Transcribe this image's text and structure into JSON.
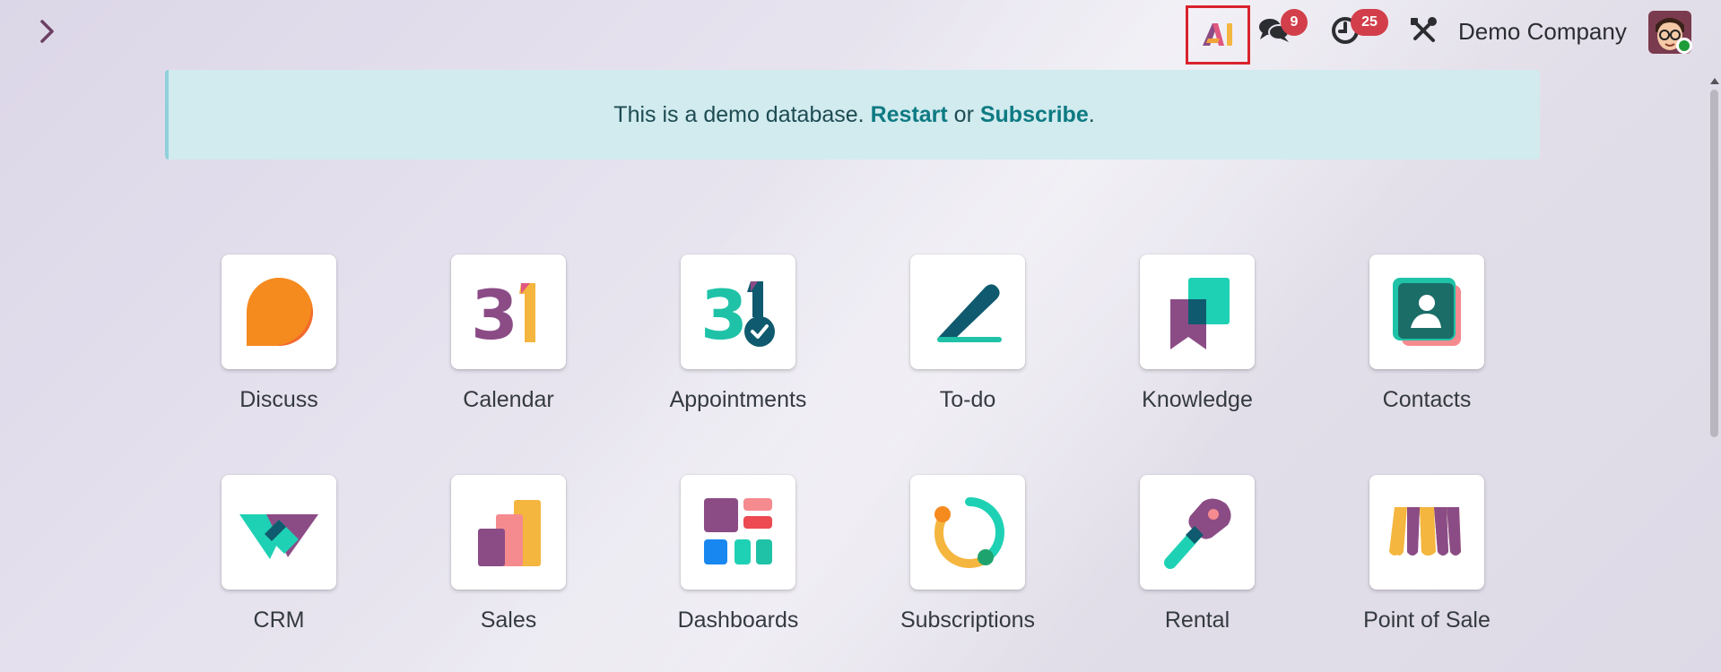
{
  "topbar": {
    "ai_icon": "ai-logo-icon",
    "messages_badge": "9",
    "activities_badge": "25",
    "company_name": "Demo Company"
  },
  "banner": {
    "text_before": "This is a demo database. ",
    "restart_label": "Restart",
    "text_middle": " or ",
    "subscribe_label": "Subscribe",
    "text_after": "."
  },
  "apps": [
    {
      "label": "Discuss",
      "icon": "discuss-icon"
    },
    {
      "label": "Calendar",
      "icon": "calendar-icon"
    },
    {
      "label": "Appointments",
      "icon": "appointments-icon"
    },
    {
      "label": "To-do",
      "icon": "todo-icon"
    },
    {
      "label": "Knowledge",
      "icon": "knowledge-icon"
    },
    {
      "label": "Contacts",
      "icon": "contacts-icon"
    },
    {
      "label": "CRM",
      "icon": "crm-icon"
    },
    {
      "label": "Sales",
      "icon": "sales-icon"
    },
    {
      "label": "Dashboards",
      "icon": "dashboards-icon"
    },
    {
      "label": "Subscriptions",
      "icon": "subscriptions-icon"
    },
    {
      "label": "Rental",
      "icon": "rental-icon"
    },
    {
      "label": "Point of Sale",
      "icon": "point-of-sale-icon"
    }
  ],
  "colors": {
    "badge": "#d23f4a",
    "highlight_box": "#d9232d",
    "banner_bg": "#d1ebef",
    "link": "#0e7a82"
  }
}
